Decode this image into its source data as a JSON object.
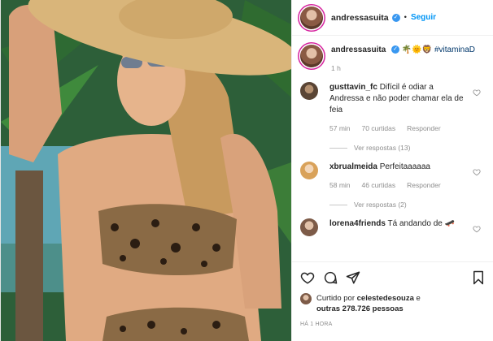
{
  "header": {
    "username": "andressasuita",
    "follow_label": "Seguir",
    "separator": "•",
    "more_label": "•••"
  },
  "caption": {
    "username": "andressasuita",
    "emoji_text": "🌴🌞🦁",
    "hashtag": "#vitaminaD",
    "time": "1 h"
  },
  "comments": [
    {
      "username": "gusttavin_fc",
      "text": "Difícil é odiar a Andressa e não poder chamar ela de feia",
      "time": "57 min",
      "likes": "70 curtidas",
      "reply_label": "Responder",
      "view_replies": "Ver respostas (13)"
    },
    {
      "username": "xbrualmeida",
      "text": "Perfeitaaaaaa",
      "time": "58 min",
      "likes": "46 curtidas",
      "reply_label": "Responder",
      "view_replies": "Ver respostas (2)"
    },
    {
      "username": "lorena4friends",
      "text": "Tá andando de 🛹"
    }
  ],
  "actions": {
    "liked_by_prefix": "Curtido por",
    "liked_by_user": "celestedesouza",
    "liked_by_and": "e",
    "others": "outras 278.726 pessoas",
    "posted_time": "HÁ 1 HORA"
  },
  "icons": {
    "like": "heart-icon",
    "comment": "comment-icon",
    "share": "paper-plane-icon",
    "save": "bookmark-icon",
    "verified": "verified-badge-icon"
  },
  "colors": {
    "link_blue": "#0095f6",
    "verified_blue": "#3897f0",
    "hashtag": "#00376b",
    "muted": "#8e8e8e"
  }
}
